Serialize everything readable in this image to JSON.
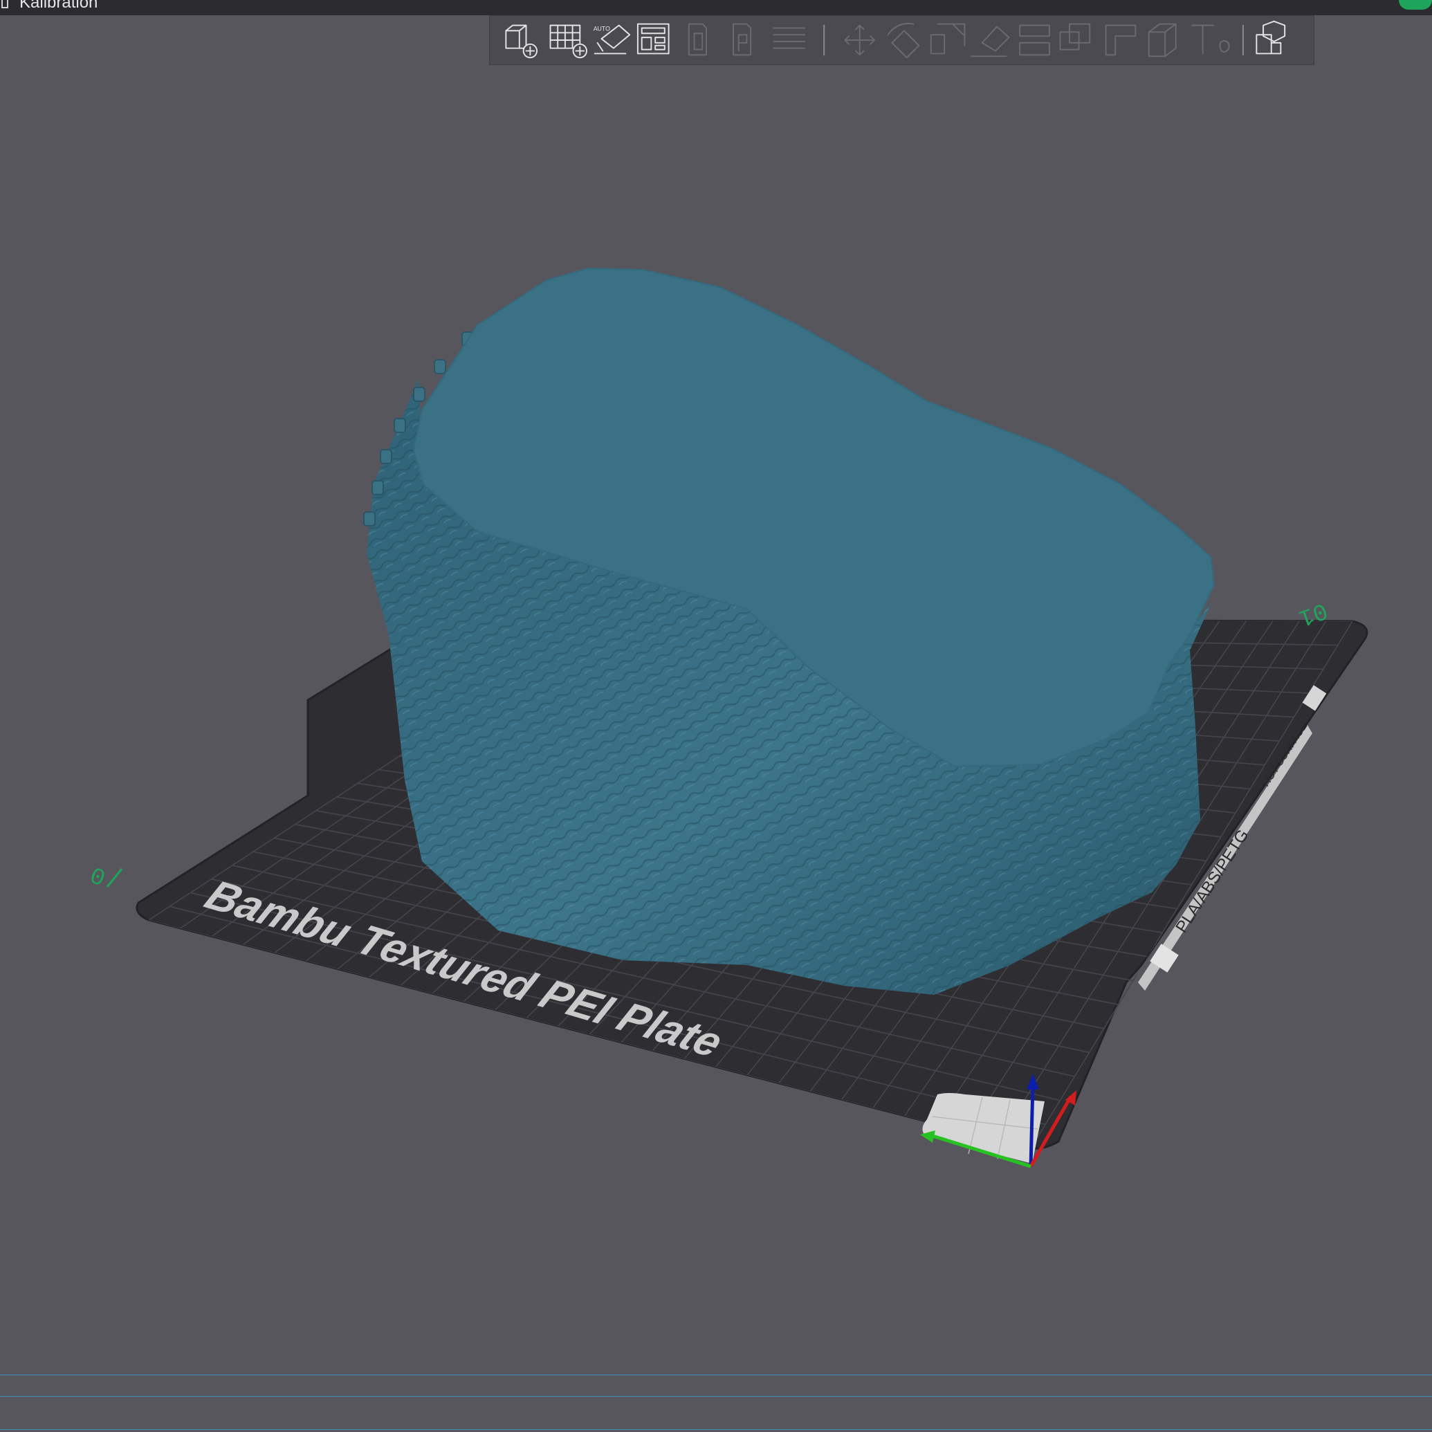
{
  "window": {
    "title": "Kalibration"
  },
  "toolbar": {
    "buttons": [
      {
        "name": "add-object-button",
        "icon": "cube-plus-icon",
        "state": "enabled"
      },
      {
        "name": "add-plate-button",
        "icon": "grid-plus-icon",
        "state": "enabled"
      },
      {
        "name": "auto-orient-button",
        "icon": "auto-orient-icon",
        "label": "AUTO",
        "state": "enabled"
      },
      {
        "name": "arrange-button",
        "icon": "arrange-icon",
        "state": "enabled"
      },
      {
        "name": "copy-button",
        "icon": "copy-icon",
        "state": "disabled"
      },
      {
        "name": "paste-button",
        "icon": "paste-icon",
        "state": "disabled"
      },
      {
        "name": "layers-button",
        "icon": "layers-icon",
        "state": "disabled"
      },
      {
        "name": "move-button",
        "icon": "move-icon",
        "state": "disabled"
      },
      {
        "name": "rotate-button",
        "icon": "rotate-icon",
        "state": "disabled"
      },
      {
        "name": "scale-button",
        "icon": "scale-icon",
        "state": "disabled"
      },
      {
        "name": "lay-on-face-button",
        "icon": "lay-on-face-icon",
        "state": "disabled"
      },
      {
        "name": "cut-button",
        "icon": "cut-icon",
        "state": "disabled"
      },
      {
        "name": "boolean-button",
        "icon": "boolean-icon",
        "state": "disabled"
      },
      {
        "name": "support-paint-button",
        "icon": "support-paint-icon",
        "state": "disabled"
      },
      {
        "name": "seam-paint-button",
        "icon": "seam-paint-icon",
        "state": "disabled"
      },
      {
        "name": "color-paint-button",
        "icon": "color-paint-icon",
        "state": "disabled"
      },
      {
        "name": "text-button",
        "icon": "text-icon",
        "state": "disabled"
      },
      {
        "name": "assembly-view-button",
        "icon": "assembly-icon",
        "state": "enabled"
      }
    ]
  },
  "plate": {
    "name": "Bambu Textured PEI Plate",
    "label_origin": "0",
    "label_index": "01",
    "filament_label": "PLA/ABS/PETG",
    "hot_surface_label": "HOT SURFACE"
  },
  "model": {
    "color": "#3b7185"
  },
  "axes": {
    "x_color": "#d11d1d",
    "y_color": "#27c222",
    "z_color": "#0d1eaa"
  },
  "colors": {
    "background": "#57565d",
    "plate": "#2e2d32",
    "grid": "#46454b",
    "accent_green": "#1fa55b"
  }
}
